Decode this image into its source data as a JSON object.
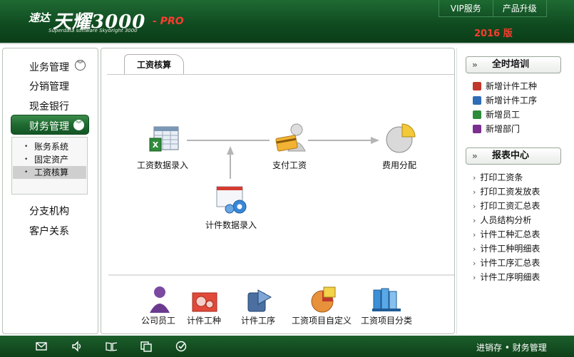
{
  "header": {
    "logo_cn": "速达",
    "logo_main": "天耀3000",
    "logo_pro": "- PRO",
    "logo_sub": "Superdata software Skybright 3000",
    "links": [
      "VIP服务",
      "产品升级"
    ],
    "edition": "2016 版"
  },
  "sidebar": {
    "items": [
      {
        "label": "业务管理"
      },
      {
        "label": "分销管理"
      },
      {
        "label": "现金银行"
      },
      {
        "label": "财务管理"
      },
      {
        "label": "分支机构"
      },
      {
        "label": "客户关系"
      }
    ],
    "sub_items": [
      "账务系统",
      "固定资产",
      "工资核算"
    ],
    "active_sub": "工资核算"
  },
  "main": {
    "tab_label": "工资核算",
    "flow": [
      {
        "label": "工资数据录入",
        "icon": "spreadsheet-icon"
      },
      {
        "label": "支付工资",
        "icon": "payment-card-icon"
      },
      {
        "label": "费用分配",
        "icon": "pie-chart-icon"
      },
      {
        "label": "计件数据录入",
        "icon": "gear-window-icon"
      }
    ],
    "shortcuts": [
      {
        "label": "公司员工",
        "icon": "employee-icon"
      },
      {
        "label": "计件工种",
        "icon": "gears-icon"
      },
      {
        "label": "计件工序",
        "icon": "process-icon"
      },
      {
        "label": "工资项目自定义",
        "icon": "custom-item-icon"
      },
      {
        "label": "工资项目分类",
        "icon": "category-books-icon"
      }
    ]
  },
  "right": {
    "training": {
      "title": "全时培训",
      "items": [
        "新增计件工种",
        "新增计件工序",
        "新增员工",
        "新增部门"
      ]
    },
    "reports": {
      "title": "报表中心",
      "items": [
        "打印工资条",
        "打印工资发放表",
        "打印工资汇总表",
        "人员结构分析",
        "计件工种汇总表",
        "计件工种明细表",
        "计件工序汇总表",
        "计件工序明细表"
      ]
    }
  },
  "footer": {
    "status": "进销存 • 财务管理",
    "icons": [
      "mail-icon",
      "speaker-icon",
      "book-icon",
      "window-icon",
      "check-icon"
    ]
  },
  "colors": {
    "brand_green": "#1d5a2a",
    "accent_red": "#ff3b2f"
  }
}
